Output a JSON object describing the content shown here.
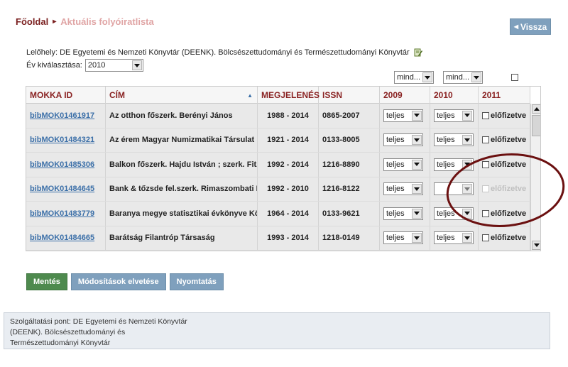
{
  "breadcrumb": {
    "home": "Főoldal",
    "separator": "▸",
    "current": "Aktuális folyóiratlista"
  },
  "back_button": {
    "label": "Vissza",
    "icon": "triangle-left-icon"
  },
  "location": {
    "label": "Lelőhely:",
    "value": "DE Egyetemi és Nemzeti Könyvtár (DEENK). Bölcsészettudományi és Természettudományi Könyvtár",
    "icon": "edit-icon"
  },
  "year_filter": {
    "label": "Év kiválasztása:",
    "selected": "2010"
  },
  "column_filters": {
    "col2010": "mind...",
    "col2011": "mind..."
  },
  "table": {
    "columns": [
      "MOKKA ID",
      "CÍM",
      "MEGJELENÉS",
      "ISSN",
      "2009",
      "2010",
      "2011"
    ],
    "sort_indicator": "▲",
    "rows": [
      {
        "id": "bibMOK01461917",
        "title": "Az otthon főszerk. Berényi János",
        "pub": "1988 - 2014",
        "issn": "0865-2007",
        "y2009": "teljes",
        "y2010": "teljes",
        "y2011": "előfizetve",
        "disabled": false
      },
      {
        "id": "bibMOK01484321",
        "title": "Az érem Magyar Numizmatikai Társulat ; fe",
        "pub": "1921 - 2014",
        "issn": "0133-8005",
        "y2009": "teljes",
        "y2010": "teljes",
        "y2011": "előfizetve",
        "disabled": false
      },
      {
        "id": "bibMOK01485306",
        "title": "Balkon főszerk. Hajdu István ; szerk. Fitz Pé",
        "pub": "1992 - 2014",
        "issn": "1216-8890",
        "y2009": "teljes",
        "y2010": "teljes",
        "y2011": "előfizetve",
        "disabled": false
      },
      {
        "id": "bibMOK01484645",
        "title": "Bank & tőzsde fel.szerk. Rimaszombati Edit",
        "pub": "1992 - 2010",
        "issn": "1216-8122",
        "y2009": "teljes",
        "y2010": "",
        "y2011": "előfizetve",
        "disabled": true
      },
      {
        "id": "bibMOK01483779",
        "title": "Baranya megye statisztikai évkönyve Közpo",
        "pub": "1964 - 2014",
        "issn": "0133-9621",
        "y2009": "teljes",
        "y2010": "teljes",
        "y2011": "előfizetve",
        "disabled": false
      },
      {
        "id": "bibMOK01484665",
        "title": "Barátság Filantróp Társaság",
        "pub": "1993 - 2014",
        "issn": "1218-0149",
        "y2009": "teljes",
        "y2010": "teljes",
        "y2011": "előfizetve",
        "disabled": false
      }
    ]
  },
  "actions": {
    "save": "Mentés",
    "discard": "Módosítások elvetése",
    "print": "Nyomtatás"
  },
  "footer": {
    "line1": "Szolgáltatási pont: DE Egyetemi és Nemzeti Könyvtár",
    "line2": "(DEENK). Bölcsészettudományi és",
    "line3": "Természettudományi Könyvtár"
  },
  "colors": {
    "accent": "#7a1f1f",
    "link": "#3b6fa8",
    "button": "#7fa0bd",
    "save_button": "#4e8a4e",
    "annotation": "#6b1010"
  }
}
